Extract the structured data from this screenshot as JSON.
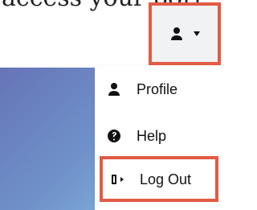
{
  "background": {
    "partial_header_text": "access your port"
  },
  "account_button": {
    "icon": "user-icon",
    "caret_icon": "chevron-down-icon",
    "highlight_color": "#e25b44"
  },
  "menu": {
    "items": [
      {
        "label": "Profile",
        "icon": "user-icon"
      },
      {
        "label": "Help",
        "icon": "question-circle-icon"
      },
      {
        "label": "Log Out",
        "icon": "sign-out-icon",
        "highlighted": true
      }
    ]
  },
  "colors": {
    "highlight": "#e25b44",
    "menu_bg": "#ffffff",
    "button_bg": "#f0f2f4",
    "hero_gradient_start": "#6674b7",
    "hero_gradient_end": "#8fc5ea"
  }
}
